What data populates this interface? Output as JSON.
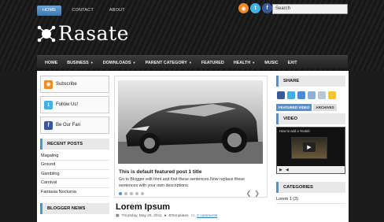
{
  "toplinks": [
    "HOME",
    "CONTACT",
    "ABOUT"
  ],
  "search": {
    "value": "Search"
  },
  "logo": {
    "text": "Rasate"
  },
  "nav": {
    "items": [
      {
        "label": "HOME",
        "caret": ""
      },
      {
        "label": "BUSINESS",
        "caret": "▼"
      },
      {
        "label": "DOWNLOADS",
        "caret": "▼"
      },
      {
        "label": "PARENT CATEGORY",
        "caret": "▼"
      },
      {
        "label": "FEATURED",
        "caret": ""
      },
      {
        "label": "HEALTH",
        "caret": "▼"
      },
      {
        "label": "MUSIC",
        "caret": ""
      },
      {
        "label": "EXIT",
        "caret": ""
      }
    ]
  },
  "social_boxes": [
    {
      "label": "Subscribe",
      "icon": "rss-icon",
      "color": "#f08a24",
      "glyph": "◉"
    },
    {
      "label": "Follow Us!",
      "icon": "twitter-icon",
      "color": "#3fb1e3",
      "glyph": "t"
    },
    {
      "label": "Be Our Fan",
      "icon": "facebook-icon",
      "color": "#3b5998",
      "glyph": "f"
    }
  ],
  "recent_posts": {
    "title": "RECENT POSTS",
    "items": [
      "Magaling",
      "Ground",
      "Gambling",
      "Carnival",
      "Fantasia Nocturna"
    ]
  },
  "blogger_news": {
    "title": "BLOGGER NEWS"
  },
  "slider": {
    "title": "This is default featured post 1 title",
    "text": "Go to Blogger edit html and find these sentences.Now replace these sentences with your own descriptions.",
    "dots": 5,
    "active_dot": 0
  },
  "post": {
    "title": "Lorem Ipsum",
    "date": "Thursday, May 26, 2011",
    "author": "BTemplates",
    "comments": "2 comments"
  },
  "share": {
    "title": "SHARE"
  },
  "video_widget": {
    "tabs": [
      "FEATURED VIDEO",
      "ARCHIVES"
    ],
    "title": "VIDEO",
    "video_title": "How to add a Youtub"
  },
  "categories": {
    "title": "CATEGORIES",
    "items": [
      "Lorem 1 (3)"
    ]
  }
}
